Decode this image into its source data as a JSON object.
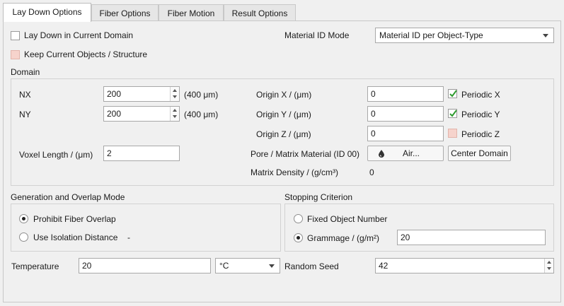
{
  "tabs": [
    {
      "label": "Lay Down Options",
      "active": true
    },
    {
      "label": "Fiber Options",
      "active": false
    },
    {
      "label": "Fiber Motion",
      "active": false
    },
    {
      "label": "Result Options",
      "active": false
    }
  ],
  "top": {
    "lay_down_label": "Lay Down in Current Domain",
    "keep_objects_label": "Keep Current Objects / Structure",
    "material_id_mode_label": "Material ID Mode",
    "material_id_mode_value": "Material ID per Object-Type"
  },
  "domain": {
    "title": "Domain",
    "nx_label": "NX",
    "nx_value": "200",
    "nx_unit": "(400 μm)",
    "ny_label": "NY",
    "ny_value": "200",
    "ny_unit": "(400 μm)",
    "voxel_label": "Voxel Length / (μm)",
    "voxel_value": "2",
    "origin_x_label": "Origin X / (μm)",
    "origin_x_value": "0",
    "origin_y_label": "Origin Y / (μm)",
    "origin_y_value": "0",
    "origin_z_label": "Origin Z / (μm)",
    "origin_z_value": "0",
    "periodic_x_label": "Periodic X",
    "periodic_x_checked": true,
    "periodic_y_label": "Periodic Y",
    "periodic_y_checked": true,
    "periodic_z_label": "Periodic Z",
    "periodic_z_checked": false,
    "pore_label": "Pore / Matrix Material (ID 00)",
    "pore_button": "Air...",
    "center_button": "Center Domain",
    "matrix_density_label": "Matrix Density / (g/cm³)",
    "matrix_density_value": "0"
  },
  "generation": {
    "title": "Generation and Overlap Mode",
    "prohibit_label": "Prohibit Fiber Overlap",
    "isolation_label": "Use Isolation Distance",
    "isolation_value": "-",
    "selected": "prohibit"
  },
  "stopping": {
    "title": "Stopping Criterion",
    "fixed_label": "Fixed Object Number",
    "grammage_label": "Grammage / (g/m²)",
    "grammage_value": "20",
    "selected": "grammage"
  },
  "bottom": {
    "temperature_label": "Temperature",
    "temperature_value": "20",
    "temperature_unit": "°C",
    "random_seed_label": "Random Seed",
    "random_seed_value": "42"
  },
  "colors": {
    "check_green": "#2e9b2e",
    "pink_box": "#f6d3cc"
  }
}
